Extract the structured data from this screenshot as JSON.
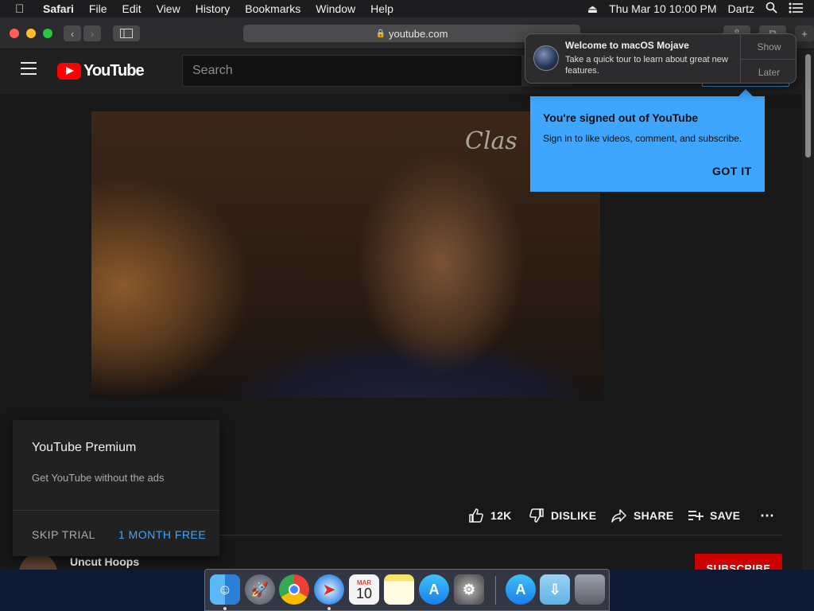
{
  "menubar": {
    "apple_icon": "apple-icon",
    "app_name": "Safari",
    "menus": [
      "File",
      "Edit",
      "View",
      "History",
      "Bookmarks",
      "Window",
      "Help"
    ],
    "datetime": "Thu Mar 10  10:00 PM",
    "user": "Dartz"
  },
  "safari": {
    "url": "youtube.com"
  },
  "youtube": {
    "logo_text": "YouTube",
    "search_placeholder": "Search",
    "actions": {
      "like_count": "12K",
      "dislike": "DISLIKE",
      "share": "SHARE",
      "save": "SAVE"
    },
    "channel_name": "Uncut Hoops",
    "subscribe": "SUBSCRIBE",
    "video_watermark": "Clas"
  },
  "premium_popup": {
    "title": "YouTube Premium",
    "description": "Get YouTube without the ads",
    "skip": "SKIP TRIAL",
    "cta": "1 MONTH FREE"
  },
  "signin_tooltip": {
    "title": "You're signed out of YouTube",
    "description": "Sign in to like videos, comment, and subscribe.",
    "button": "GOT IT"
  },
  "notification": {
    "title": "Welcome to macOS Mojave",
    "body": "Take a quick tour to learn about great new features.",
    "show": "Show",
    "later": "Later"
  },
  "dock": {
    "calendar_month": "MAR",
    "calendar_day": "10"
  },
  "colors": {
    "youtube_red": "#ff0000",
    "tooltip_blue": "#3ea6ff",
    "subscribe_red": "#cc0000"
  }
}
